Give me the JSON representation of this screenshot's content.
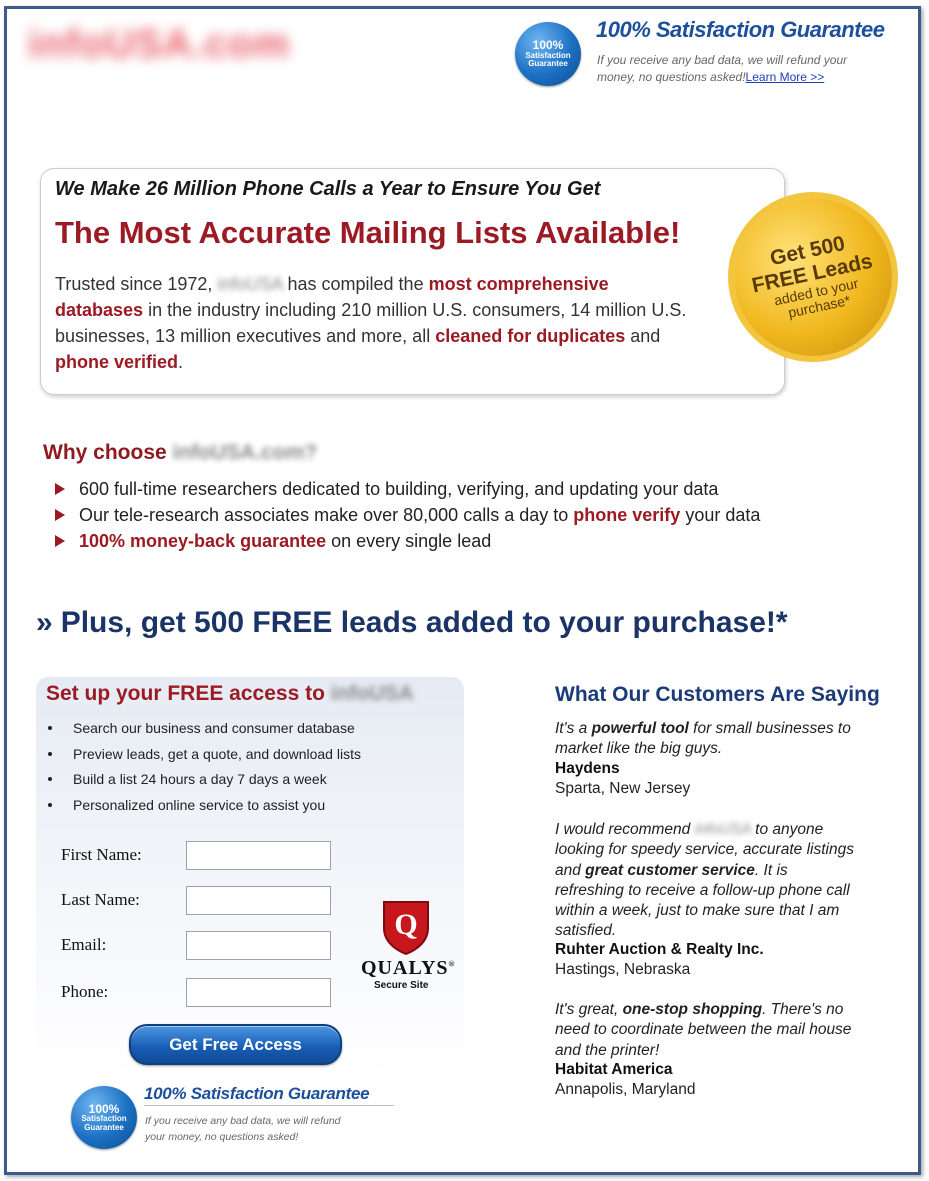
{
  "header": {
    "logo_text": "infoUSA.com",
    "seal": {
      "line1": "100%",
      "line2": "Satisfaction",
      "line3": "Guarantee"
    },
    "guarantee_title": "100% Satisfaction Guarantee",
    "guarantee_line1": "If you receive any bad data, we will refund your",
    "guarantee_line2": "money, no questions asked!",
    "learn_more": "Learn More >>"
  },
  "hero": {
    "subtitle": "We Make 26 Million Phone Calls a Year to Ensure You Get",
    "title": "The Most Accurate Mailing Lists Available!",
    "body_1": "Trusted since 1972,",
    "body_brand": "infoUSA",
    "body_2": "has compiled the",
    "hl_1": "most comprehensive databases",
    "body_3": "in the industry including 210 million U.S. consumers, 14 million U.S. businesses, 13 million executives and more, all",
    "hl_2": "cleaned for duplicates",
    "body_4": "and",
    "hl_3": "phone verified",
    "body_5": "."
  },
  "badge": {
    "line1": "Get 500",
    "line2": "FREE Leads",
    "line3": "added to your",
    "line4": "purchase*"
  },
  "why": {
    "label": "Why choose",
    "brand": "infoUSA.com?",
    "b1": "600 full-time researchers dedicated to building, verifying, and updating your data",
    "b2_pre": "Our tele-research associates make over 80,000 calls a day to",
    "b2_hl": "phone verify",
    "b2_post": "your data",
    "b3_hl": "100% money-back guarantee",
    "b3_post": "on every single lead"
  },
  "plus": {
    "chevron": "»",
    "text": "Plus, get 500 FREE leads added to your purchase!*"
  },
  "form": {
    "title": "Set up your FREE access to",
    "title_brand": "infoUSA",
    "items": [
      "Search our business and consumer database",
      "Preview leads, get a quote, and download lists",
      "Build a list 24 hours a day 7 days a week",
      "Personalized online service to assist you"
    ],
    "first_name_label": "First Name:",
    "last_name_label": "Last Name:",
    "email_label": "Email:",
    "phone_label": "Phone:",
    "first_name_value": "",
    "last_name_value": "",
    "email_value": "",
    "phone_value": "",
    "submit_label": "Get Free Access",
    "qualys_name": "QUALYS",
    "qualys_mark": "®",
    "qualys_sub": "Secure Site",
    "qualys_letter": "Q"
  },
  "footer_guarantee": {
    "seal": {
      "line1": "100%",
      "line2": "Satisfaction",
      "line3": "Guarantee"
    },
    "title": "100% Satisfaction Guarantee",
    "line1": "If you receive any bad data, we will refund",
    "line2": "your money, no questions asked!"
  },
  "testimonials": {
    "heading": "What Our Customers Are Saying",
    "t1": {
      "l1_pre": "It's a ",
      "l1_b": "powerful tool",
      "l1_post": " for small businesses to",
      "l2": "market like the big guys.",
      "name": "Haydens",
      "location": "Sparta, New Jersey"
    },
    "t2": {
      "l1_pre": "I would recommend ",
      "l1_brand": "infoUSA",
      "l1_post": " to anyone",
      "l2": "looking for speedy service, accurate listings",
      "l3_pre": "and ",
      "l3_b": "great customer service",
      "l3_post": ".  It is",
      "l4": "refreshing to receive a follow-up phone call",
      "l5": "within a week, just to make sure that I am",
      "l6": "satisfied.",
      "name": "Ruhter Auction & Realty Inc.",
      "location": "Hastings, Nebraska"
    },
    "t3": {
      "l1_pre": "It's great, ",
      "l1_b": "one-stop shopping",
      "l1_post": ". There's no",
      "l2": "need to coordinate between the mail house",
      "l3": "and the printer!",
      "name": "Habitat America",
      "location": "Annapolis, Maryland"
    }
  }
}
